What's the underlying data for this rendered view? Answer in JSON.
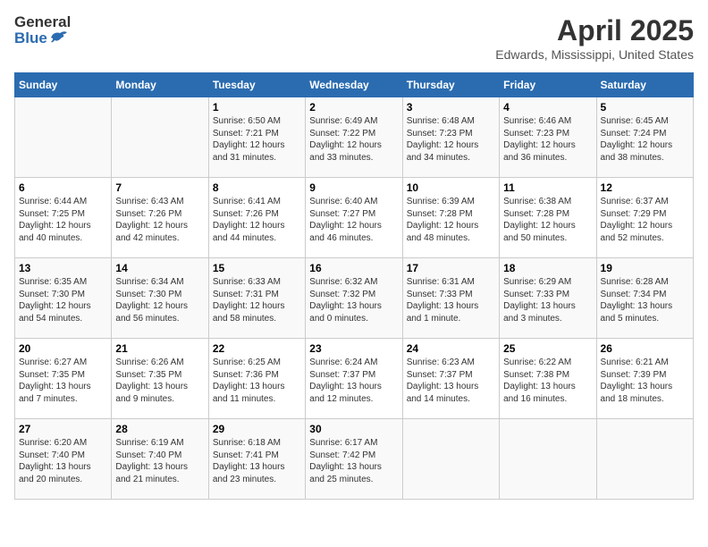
{
  "logo": {
    "general": "General",
    "blue": "Blue"
  },
  "title": "April 2025",
  "location": "Edwards, Mississippi, United States",
  "headers": [
    "Sunday",
    "Monday",
    "Tuesday",
    "Wednesday",
    "Thursday",
    "Friday",
    "Saturday"
  ],
  "weeks": [
    [
      {
        "day": "",
        "info": ""
      },
      {
        "day": "",
        "info": ""
      },
      {
        "day": "1",
        "info": "Sunrise: 6:50 AM\nSunset: 7:21 PM\nDaylight: 12 hours\nand 31 minutes."
      },
      {
        "day": "2",
        "info": "Sunrise: 6:49 AM\nSunset: 7:22 PM\nDaylight: 12 hours\nand 33 minutes."
      },
      {
        "day": "3",
        "info": "Sunrise: 6:48 AM\nSunset: 7:23 PM\nDaylight: 12 hours\nand 34 minutes."
      },
      {
        "day": "4",
        "info": "Sunrise: 6:46 AM\nSunset: 7:23 PM\nDaylight: 12 hours\nand 36 minutes."
      },
      {
        "day": "5",
        "info": "Sunrise: 6:45 AM\nSunset: 7:24 PM\nDaylight: 12 hours\nand 38 minutes."
      }
    ],
    [
      {
        "day": "6",
        "info": "Sunrise: 6:44 AM\nSunset: 7:25 PM\nDaylight: 12 hours\nand 40 minutes."
      },
      {
        "day": "7",
        "info": "Sunrise: 6:43 AM\nSunset: 7:26 PM\nDaylight: 12 hours\nand 42 minutes."
      },
      {
        "day": "8",
        "info": "Sunrise: 6:41 AM\nSunset: 7:26 PM\nDaylight: 12 hours\nand 44 minutes."
      },
      {
        "day": "9",
        "info": "Sunrise: 6:40 AM\nSunset: 7:27 PM\nDaylight: 12 hours\nand 46 minutes."
      },
      {
        "day": "10",
        "info": "Sunrise: 6:39 AM\nSunset: 7:28 PM\nDaylight: 12 hours\nand 48 minutes."
      },
      {
        "day": "11",
        "info": "Sunrise: 6:38 AM\nSunset: 7:28 PM\nDaylight: 12 hours\nand 50 minutes."
      },
      {
        "day": "12",
        "info": "Sunrise: 6:37 AM\nSunset: 7:29 PM\nDaylight: 12 hours\nand 52 minutes."
      }
    ],
    [
      {
        "day": "13",
        "info": "Sunrise: 6:35 AM\nSunset: 7:30 PM\nDaylight: 12 hours\nand 54 minutes."
      },
      {
        "day": "14",
        "info": "Sunrise: 6:34 AM\nSunset: 7:30 PM\nDaylight: 12 hours\nand 56 minutes."
      },
      {
        "day": "15",
        "info": "Sunrise: 6:33 AM\nSunset: 7:31 PM\nDaylight: 12 hours\nand 58 minutes."
      },
      {
        "day": "16",
        "info": "Sunrise: 6:32 AM\nSunset: 7:32 PM\nDaylight: 13 hours\nand 0 minutes."
      },
      {
        "day": "17",
        "info": "Sunrise: 6:31 AM\nSunset: 7:33 PM\nDaylight: 13 hours\nand 1 minute."
      },
      {
        "day": "18",
        "info": "Sunrise: 6:29 AM\nSunset: 7:33 PM\nDaylight: 13 hours\nand 3 minutes."
      },
      {
        "day": "19",
        "info": "Sunrise: 6:28 AM\nSunset: 7:34 PM\nDaylight: 13 hours\nand 5 minutes."
      }
    ],
    [
      {
        "day": "20",
        "info": "Sunrise: 6:27 AM\nSunset: 7:35 PM\nDaylight: 13 hours\nand 7 minutes."
      },
      {
        "day": "21",
        "info": "Sunrise: 6:26 AM\nSunset: 7:35 PM\nDaylight: 13 hours\nand 9 minutes."
      },
      {
        "day": "22",
        "info": "Sunrise: 6:25 AM\nSunset: 7:36 PM\nDaylight: 13 hours\nand 11 minutes."
      },
      {
        "day": "23",
        "info": "Sunrise: 6:24 AM\nSunset: 7:37 PM\nDaylight: 13 hours\nand 12 minutes."
      },
      {
        "day": "24",
        "info": "Sunrise: 6:23 AM\nSunset: 7:37 PM\nDaylight: 13 hours\nand 14 minutes."
      },
      {
        "day": "25",
        "info": "Sunrise: 6:22 AM\nSunset: 7:38 PM\nDaylight: 13 hours\nand 16 minutes."
      },
      {
        "day": "26",
        "info": "Sunrise: 6:21 AM\nSunset: 7:39 PM\nDaylight: 13 hours\nand 18 minutes."
      }
    ],
    [
      {
        "day": "27",
        "info": "Sunrise: 6:20 AM\nSunset: 7:40 PM\nDaylight: 13 hours\nand 20 minutes."
      },
      {
        "day": "28",
        "info": "Sunrise: 6:19 AM\nSunset: 7:40 PM\nDaylight: 13 hours\nand 21 minutes."
      },
      {
        "day": "29",
        "info": "Sunrise: 6:18 AM\nSunset: 7:41 PM\nDaylight: 13 hours\nand 23 minutes."
      },
      {
        "day": "30",
        "info": "Sunrise: 6:17 AM\nSunset: 7:42 PM\nDaylight: 13 hours\nand 25 minutes."
      },
      {
        "day": "",
        "info": ""
      },
      {
        "day": "",
        "info": ""
      },
      {
        "day": "",
        "info": ""
      }
    ]
  ]
}
